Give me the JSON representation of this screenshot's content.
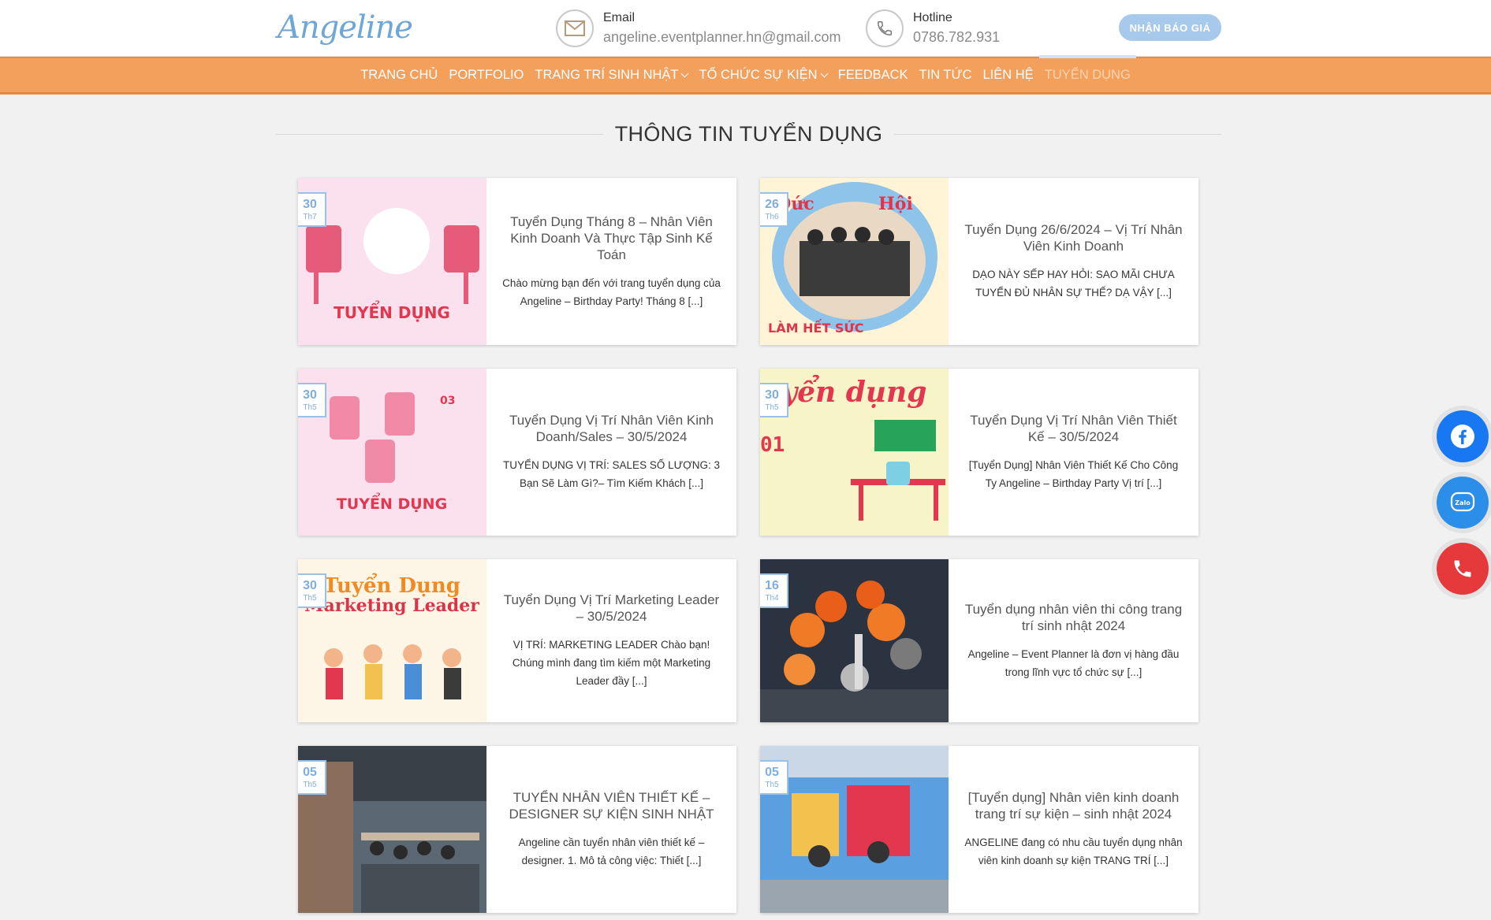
{
  "header": {
    "logo_text": "Angeline",
    "email": {
      "label": "Email",
      "value": "angeline.eventplanner.hn@gmail.com"
    },
    "hotline": {
      "label": "Hotline",
      "value": "0786.782.931"
    },
    "quote_button": "NHẬN BÁO GIÁ"
  },
  "nav": {
    "items": [
      {
        "label": "TRANG CHỦ"
      },
      {
        "label": "PORTFOLIO"
      },
      {
        "label": "TRANG TRÍ SINH NHẬT"
      },
      {
        "label": "TỔ CHỨC SỰ KIỆN"
      },
      {
        "label": "FEEDBACK"
      },
      {
        "label": "TIN TỨC"
      },
      {
        "label": "LIÊN HỆ"
      },
      {
        "label": "TUYỂN DỤNG"
      }
    ]
  },
  "section_title": "THÔNG TIN TUYỂN DỤNG",
  "posts": [
    {
      "day": "30",
      "month": "Th7",
      "title": "Tuyển Dụng Tháng 8 – Nhân Viên Kinh Doanh Và Thực Tập Sinh Kế Toán",
      "excerpt": "Chào mừng bạn đến với trang tuyển dụng của Angeline – Birthday Party! Tháng 8 [...]",
      "thumb_text": "TUYỂN DỤNG"
    },
    {
      "day": "26",
      "month": "Th6",
      "title": "Tuyển Dụng 26/6/2024 – Vị Trí Nhân Viên Kinh Doanh",
      "excerpt": "DẠO NÀY SẾP HAY HỎI: SAO MÃI CHƯA TUYỂN ĐỦ NHÂN SỰ THẾ? DẠ VẬY [...]",
      "thumb_text": "LÀM HẾT SỨC"
    },
    {
      "day": "30",
      "month": "Th5",
      "title": "Tuyển Dụng Vị Trí Nhân Viên Kinh Doanh/Sales – 30/5/2024",
      "excerpt": "TUYỂN DỤNG VỊ TRÍ: SALES SỐ LƯỢNG: 3 Bạn Sẽ Làm Gì?– Tìm Kiếm Khách [...]",
      "thumb_text": "TUYỂN DỤNG"
    },
    {
      "day": "30",
      "month": "Th5",
      "title": "Tuyển Dụng Vị Trí Nhân Viên Thiết Kế – 30/5/2024",
      "excerpt": "[Tuyển Dụng] Nhân Viên Thiết Kế Cho Công Ty Angeline – Birthday Party Vị trí [...]",
      "thumb_text": "uyển dụng"
    },
    {
      "day": "30",
      "month": "Th5",
      "title": "Tuyển Dụng Vị Trí Marketing Leader – 30/5/2024",
      "excerpt": "VỊ TRÍ: MARKETING LEADER Chào bạn! Chúng mình đang tìm kiếm một  Marketing Leader đầy [...]",
      "thumb_text": "Tuyển Dụng"
    },
    {
      "day": "16",
      "month": "Th4",
      "title": "Tuyển dụng nhân viên thi công trang trí sinh nhật 2024",
      "excerpt": "Angeline – Event Planner  là đơn vị hàng đầu trong lĩnh vực tổ chức sự [...]",
      "thumb_text": ""
    },
    {
      "day": "05",
      "month": "Th5",
      "title": "TUYỂN NHÂN VIÊN THIẾT KẾ – DESIGNER SỰ KIỆN SINH NHẬT",
      "excerpt": "Angeline cần tuyển nhân viên thiết kế – designer. 1. Mô tả công việc: Thiết [...]",
      "thumb_text": ""
    },
    {
      "day": "05",
      "month": "Th5",
      "title": "[Tuyển dụng] Nhân viên kinh doanh trang trí sự kiện – sinh nhật 2024",
      "excerpt": "ANGELINE đang có nhu cầu tuyển dụng nhân viên kinh doanh sự kiện TRANG TRÍ [...]",
      "thumb_text": ""
    }
  ],
  "social": {
    "facebook": "facebook-icon",
    "zalo": "Zalo",
    "phone": "phone-icon"
  },
  "colors": {
    "nav_bg": "#f3a05d",
    "accent_blue": "#9cc1e8",
    "facebook": "#1877f2",
    "zalo": "#2b8ee8",
    "phone": "#e5393b"
  }
}
